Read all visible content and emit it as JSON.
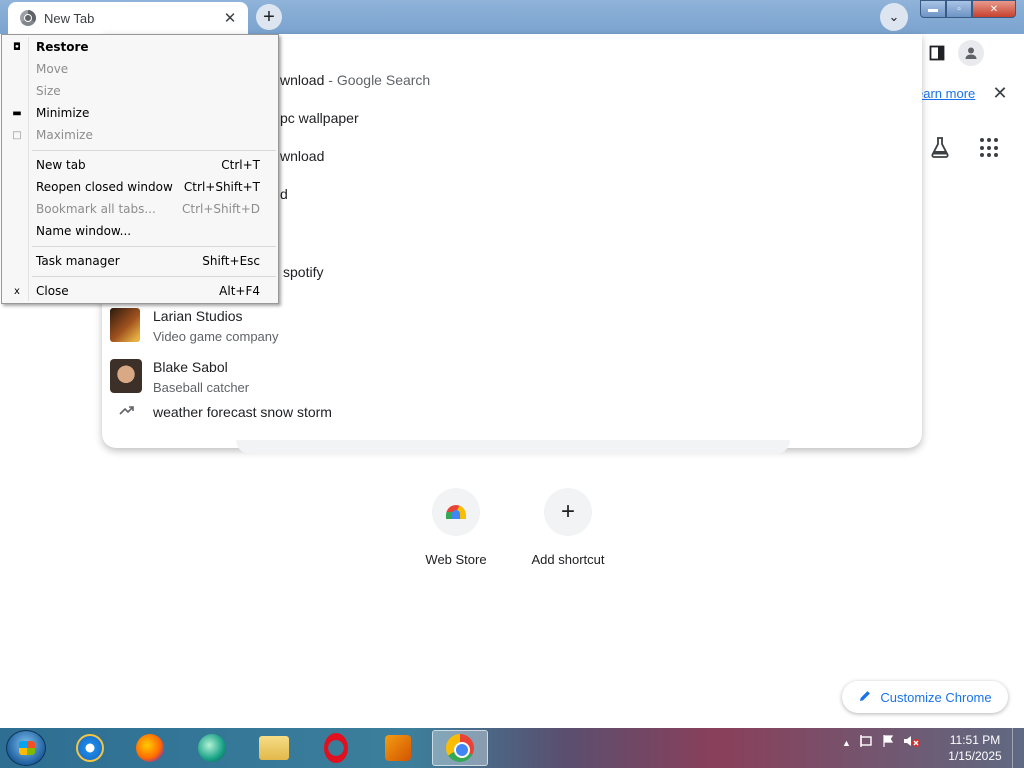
{
  "browser": {
    "tab_title": "New Tab",
    "tab_close_glyph": "✕",
    "new_tab_glyph": "+",
    "tab_search_glyph": "⌄",
    "window_controls": {
      "min": "▬",
      "max": "▫",
      "close": "✕"
    }
  },
  "toolbar": {
    "infobar_link": "earn more",
    "infobar_close": "✕"
  },
  "omnibox": {
    "suggestions": [
      {
        "text": "wnload",
        "sub": " - Google Search"
      },
      {
        "text": "pc wallpaper"
      },
      {
        "text": "wnload"
      },
      {
        "text": "d"
      },
      {
        "text": ""
      },
      {
        "text": "spotify"
      }
    ],
    "entities": [
      {
        "title": "Larian Studios",
        "desc": "Video game company"
      },
      {
        "title": "Blake Sabol",
        "desc": "Baseball catcher"
      }
    ],
    "trend": {
      "text": "weather forecast snow storm"
    }
  },
  "ntp": {
    "shortcuts": [
      {
        "label": "Web Store"
      },
      {
        "label": "Add shortcut"
      }
    ],
    "customize_label": "Customize Chrome"
  },
  "system_menu": {
    "items": [
      {
        "icon": "◘",
        "label": "Restore",
        "accel": "",
        "disabled": false,
        "bold": true
      },
      {
        "icon": "",
        "label": "Move",
        "accel": "",
        "disabled": true
      },
      {
        "icon": "",
        "label": "Size",
        "accel": "",
        "disabled": true
      },
      {
        "icon": "▬",
        "label": "Minimize",
        "accel": "",
        "disabled": false
      },
      {
        "icon": "□",
        "label": "Maximize",
        "accel": "",
        "disabled": true
      },
      {
        "icon": "",
        "label": "New tab",
        "accel": "Ctrl+T",
        "disabled": false
      },
      {
        "icon": "",
        "label": "Reopen closed window",
        "accel": "Ctrl+Shift+T",
        "disabled": false
      },
      {
        "icon": "",
        "label": "Bookmark all tabs...",
        "accel": "Ctrl+Shift+D",
        "disabled": true
      },
      {
        "icon": "",
        "label": "Name window...",
        "accel": "",
        "disabled": false
      },
      {
        "icon": "",
        "label": "Task manager",
        "accel": "Shift+Esc",
        "disabled": false
      },
      {
        "icon": "x",
        "label": "Close",
        "accel": "Alt+F4",
        "disabled": false
      }
    ]
  },
  "taskbar": {
    "clock_time": "11:51 PM",
    "clock_date": "1/15/2025",
    "tray_up_glyph": "▲"
  }
}
